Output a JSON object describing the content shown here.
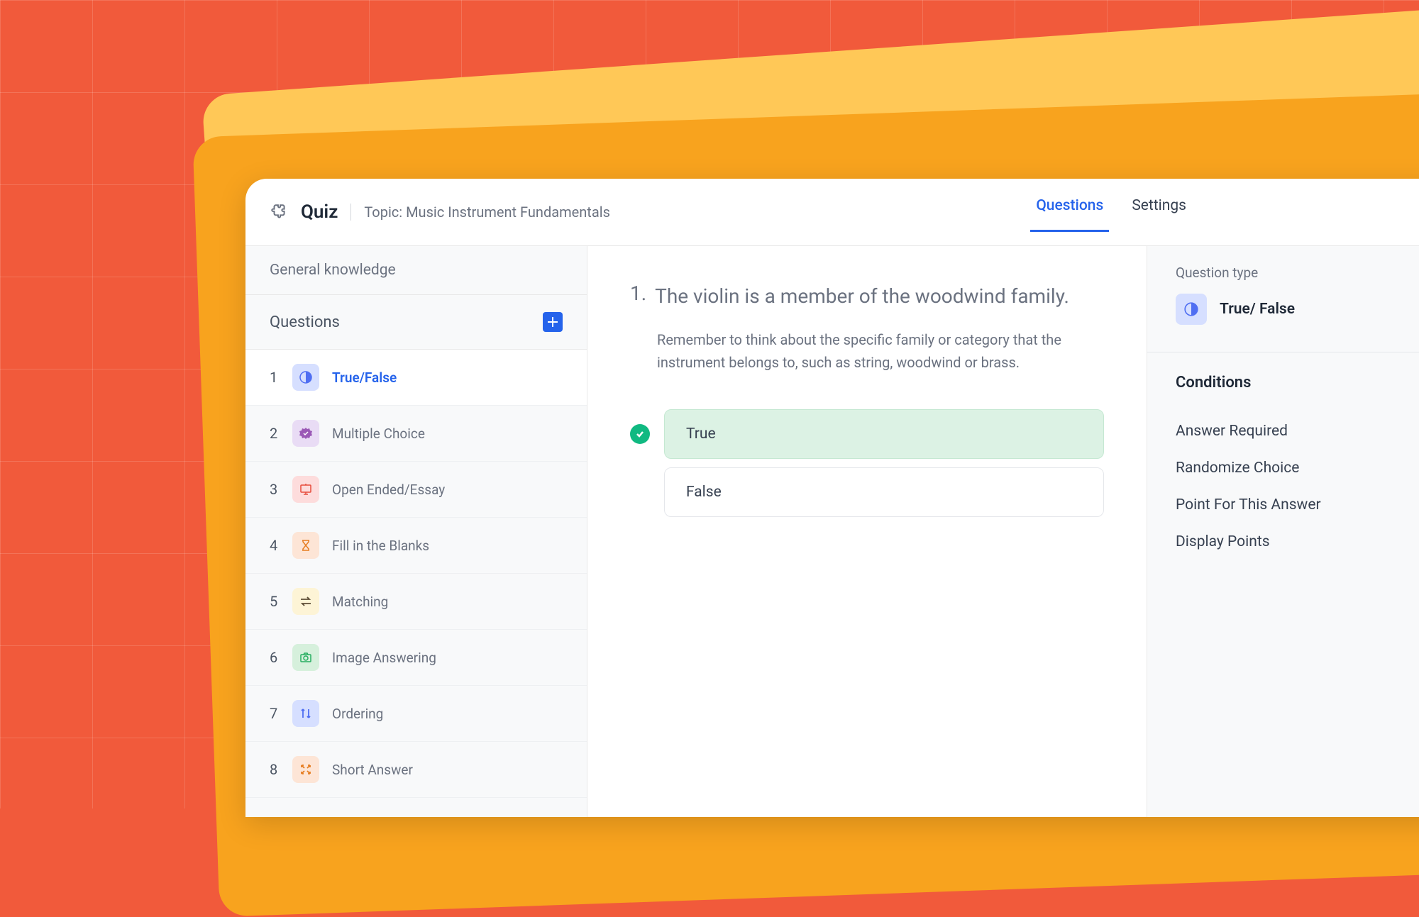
{
  "header": {
    "title": "Quiz",
    "topic_prefix": "Topic:",
    "topic": "Music Instrument Fundamentals"
  },
  "tabs": {
    "questions": "Questions",
    "settings": "Settings"
  },
  "sidebar": {
    "category": "General knowledge",
    "questions_header": "Questions",
    "items": [
      {
        "num": "1",
        "label": "True/False"
      },
      {
        "num": "2",
        "label": "Multiple Choice"
      },
      {
        "num": "3",
        "label": "Open Ended/Essay"
      },
      {
        "num": "4",
        "label": "Fill in the Blanks"
      },
      {
        "num": "5",
        "label": "Matching"
      },
      {
        "num": "6",
        "label": "Image Answering"
      },
      {
        "num": "7",
        "label": "Ordering"
      },
      {
        "num": "8",
        "label": "Short Answer"
      }
    ]
  },
  "question": {
    "number": "1.",
    "text": "The violin is a member of the woodwind family.",
    "hint": "Remember to think about the specific family or category that the instrument belongs to, such as string, woodwind or brass.",
    "answers": {
      "true": "True",
      "false": "False"
    }
  },
  "panel": {
    "type_label": "Question type",
    "type_name": "True/ False",
    "conditions_title": "Conditions",
    "conditions": {
      "answer_required": "Answer Required",
      "randomize": "Randomize Choice",
      "points": "Point For This Answer",
      "display_points": "Display Points"
    }
  }
}
